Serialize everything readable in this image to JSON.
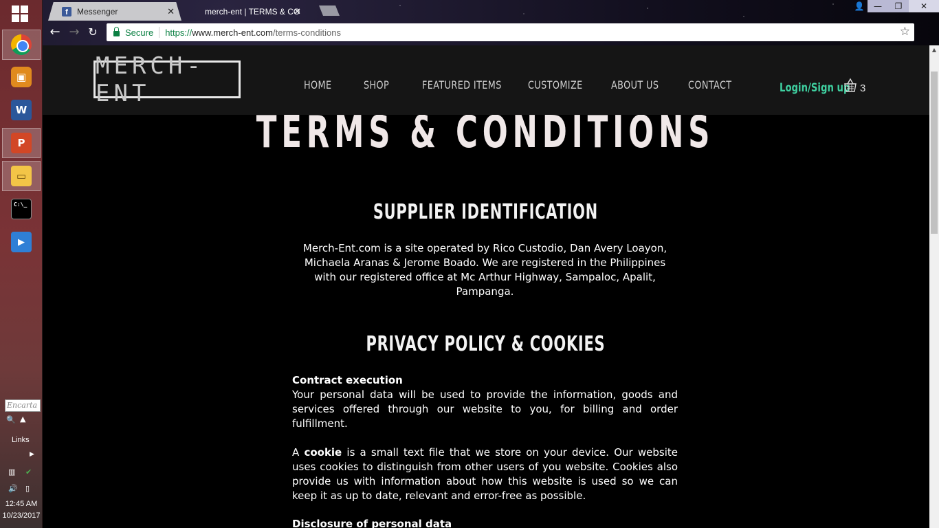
{
  "taskbar": {
    "encarta_placeholder": "Encarta",
    "links_label": "Links",
    "clock_time": "12:45 AM",
    "clock_date": "10/23/2017"
  },
  "browser": {
    "tabs": [
      {
        "title": "Messenger",
        "favicon": "facebook-icon"
      },
      {
        "title": "merch-ent | TERMS & CO"
      }
    ],
    "secure_label": "Secure",
    "url_scheme": "https://",
    "url_host": "www.merch-ent.com",
    "url_path": "/terms-conditions"
  },
  "site": {
    "logo": "MERCH-ENT",
    "nav": [
      "HOME",
      "SHOP",
      "FEATURED ITEMS",
      "CUSTOMIZE",
      "ABOUT US",
      "CONTACT"
    ],
    "login": "Login/Sign up",
    "cart_count": "3",
    "accent_color": "#3fd0a0"
  },
  "page": {
    "title": "TERMS & CONDITIONS",
    "sections": [
      {
        "heading": "SUPPLIER IDENTIFICATION",
        "body": "Merch-Ent.com is a site operated by Rico Custodio, Dan Avery Loayon, Michaela Aranas & Jerome Boado. We are registered in the Philippines with our registered office at Mc Arthur Highway, Sampaloc, Apalit, Pampanga."
      },
      {
        "heading": "PRIVACY POLICY & COOKIES",
        "contract_title": "Contract execution",
        "contract_body": "Your personal data will be used to provide the information, goods and services offered through our website to you, for billing and order fulfillment.",
        "cookie_prefix": "A",
        "cookie_word": "cookie",
        "cookie_body": "is a small text file that we store on your device. Our website uses cookies to distinguish from other users of you website. Cookies also provide us with information about how this website is used so we can keep it as up to date, relevant and error-free as possible.",
        "disclosure_title": "Disclosure of personal data"
      }
    ]
  }
}
